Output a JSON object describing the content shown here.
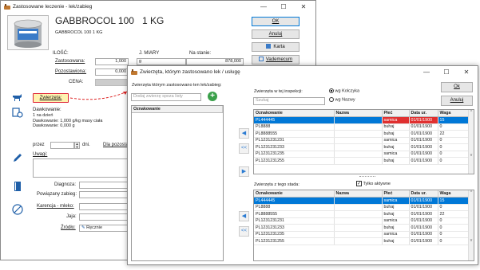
{
  "back": {
    "title": "Zastosowane leczenie - lek/zabieg",
    "product_name": "GABBROCOL 100",
    "product_unit": "1 KG",
    "product_sub": "GABBROCOL 100   1 KG",
    "ok": "OK",
    "cancel": "Anuluj",
    "card": "Karta",
    "vademecum": "Vademecum",
    "ilosc_lbl": "ILOŚĆ:",
    "jmiary_lbl": "J. MIARY",
    "nastanie_lbl": "Na stanie:",
    "zastosowana_lbl": "Zastosowana:",
    "zastosowana_val": "1,000",
    "jm_val": "g",
    "nastanie_val": "878,000",
    "pozostawiona_lbl": "Pozostawiona:",
    "pozostawiona_val": "0,000",
    "cena_lbl": "CENA:",
    "zwierzeta_btn": "Zwierzęta:",
    "dawkowanie_lbl": "Dawkowanie:",
    "dawkowanie_lines": [
      "1 na dzień",
      "Dawkowanie: 1,000 g/kg masy ciała",
      "Dawkowanie: 0,000 g"
    ],
    "przez_lbl": "przez",
    "dni_lbl": "dni.",
    "dla_lbl": "Dla pozosta",
    "uwagi_lbl": "Uwagi:",
    "diagnoza_lbl": "Diagnoza:",
    "powiazany_lbl": "Powiązany zabieg:",
    "karencja_lbl": "Karencja - mleko:",
    "jaja_lbl": "Jaja:",
    "zrodlo_lbl": "Źródło:",
    "zrodlo_val": "Ręcznie"
  },
  "front": {
    "title": "Zwierzęta, którym zastosowano lek / usługę",
    "left_caption": "Zwierzęta którym zastosowano ten lek/zabieg:",
    "left_placeholder": "Dodaj zwierzę spoza listy",
    "left_col": "Oznakowanie",
    "search_caption": "Zwierzęta w tej inspekcji:",
    "search_placeholder": "Szukaj",
    "radio1": "wg Kolczyka",
    "radio2": "wg Nazwy",
    "ok": "Ok",
    "cancel": "Anuluj",
    "columns": [
      "Oznakowanie",
      "Nazwa",
      "Płeć",
      "Data ur.",
      "Waga"
    ],
    "rows": [
      [
        "PL444445",
        "",
        "samica",
        "01/01/1900",
        "15"
      ],
      [
        "PL8888",
        "",
        "buhaj",
        "01/01/1900",
        "0"
      ],
      [
        "PL8888555",
        "",
        "buhaj",
        "01/01/1900",
        "22"
      ],
      [
        "PL1231231231",
        "",
        "samica",
        "01/01/1900",
        "0"
      ],
      [
        "PL1231231233",
        "",
        "buhaj",
        "01/01/1900",
        "0"
      ],
      [
        "PL1231231235",
        "",
        "samica",
        "01/01/1900",
        "0"
      ],
      [
        "PL1231231255",
        "",
        "buhaj",
        "01/01/1900",
        "0"
      ]
    ],
    "herd_caption": "Zwierzęta z tego stada:",
    "only_active": "Tylko aktywne",
    "herd_rows": [
      [
        "PL444445",
        "",
        "samica",
        "01/01/1900",
        "15"
      ],
      [
        "PL8888",
        "",
        "buhaj",
        "01/01/1900",
        "0"
      ],
      [
        "PL8888555",
        "",
        "buhaj",
        "01/01/1900",
        "22"
      ],
      [
        "PL1231231231",
        "",
        "samica",
        "01/01/1900",
        "0"
      ],
      [
        "PL1231231233",
        "",
        "buhaj",
        "01/01/1900",
        "0"
      ],
      [
        "PL1231231235",
        "",
        "samica",
        "01/01/1900",
        "0"
      ],
      [
        "PL1231231255",
        "",
        "buhaj",
        "01/01/1900",
        "0"
      ]
    ],
    "arrow_left": "◀",
    "arrow_dbl": "<<",
    "arrow_right": "▶"
  },
  "colors": {
    "accent": "#0078d7",
    "selected_red": "#e03030",
    "highlight": "#fff3b0"
  }
}
